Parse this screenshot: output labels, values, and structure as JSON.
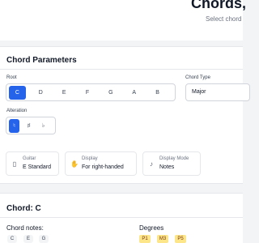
{
  "header": {
    "title": "Chords,",
    "subtitle": "Select chord"
  },
  "params": {
    "title": "Chord Parameters",
    "root_label": "Root",
    "roots": [
      "C",
      "D",
      "E",
      "F",
      "G",
      "A",
      "B"
    ],
    "selected_root": "C",
    "chord_type_label": "Chord Type",
    "chord_type_value": "Major",
    "alteration_label": "Alteration",
    "alterations": [
      "♮",
      "♯",
      "♭"
    ],
    "selected_alteration": "♮",
    "info": [
      {
        "icon": "guitar-icon",
        "key": "Guitar",
        "value": "E Standard"
      },
      {
        "icon": "hand-icon",
        "key": "Display",
        "value": "For right-handed"
      },
      {
        "icon": "music-note-icon",
        "key": "Display Mode",
        "value": "Notes"
      }
    ]
  },
  "chord": {
    "title": "Chord: C",
    "notes_label": "Chord notes:",
    "notes": [
      "C",
      "E",
      "G"
    ],
    "degrees_label": "Degrees",
    "degrees": [
      "P1",
      "M3",
      "P5"
    ]
  }
}
